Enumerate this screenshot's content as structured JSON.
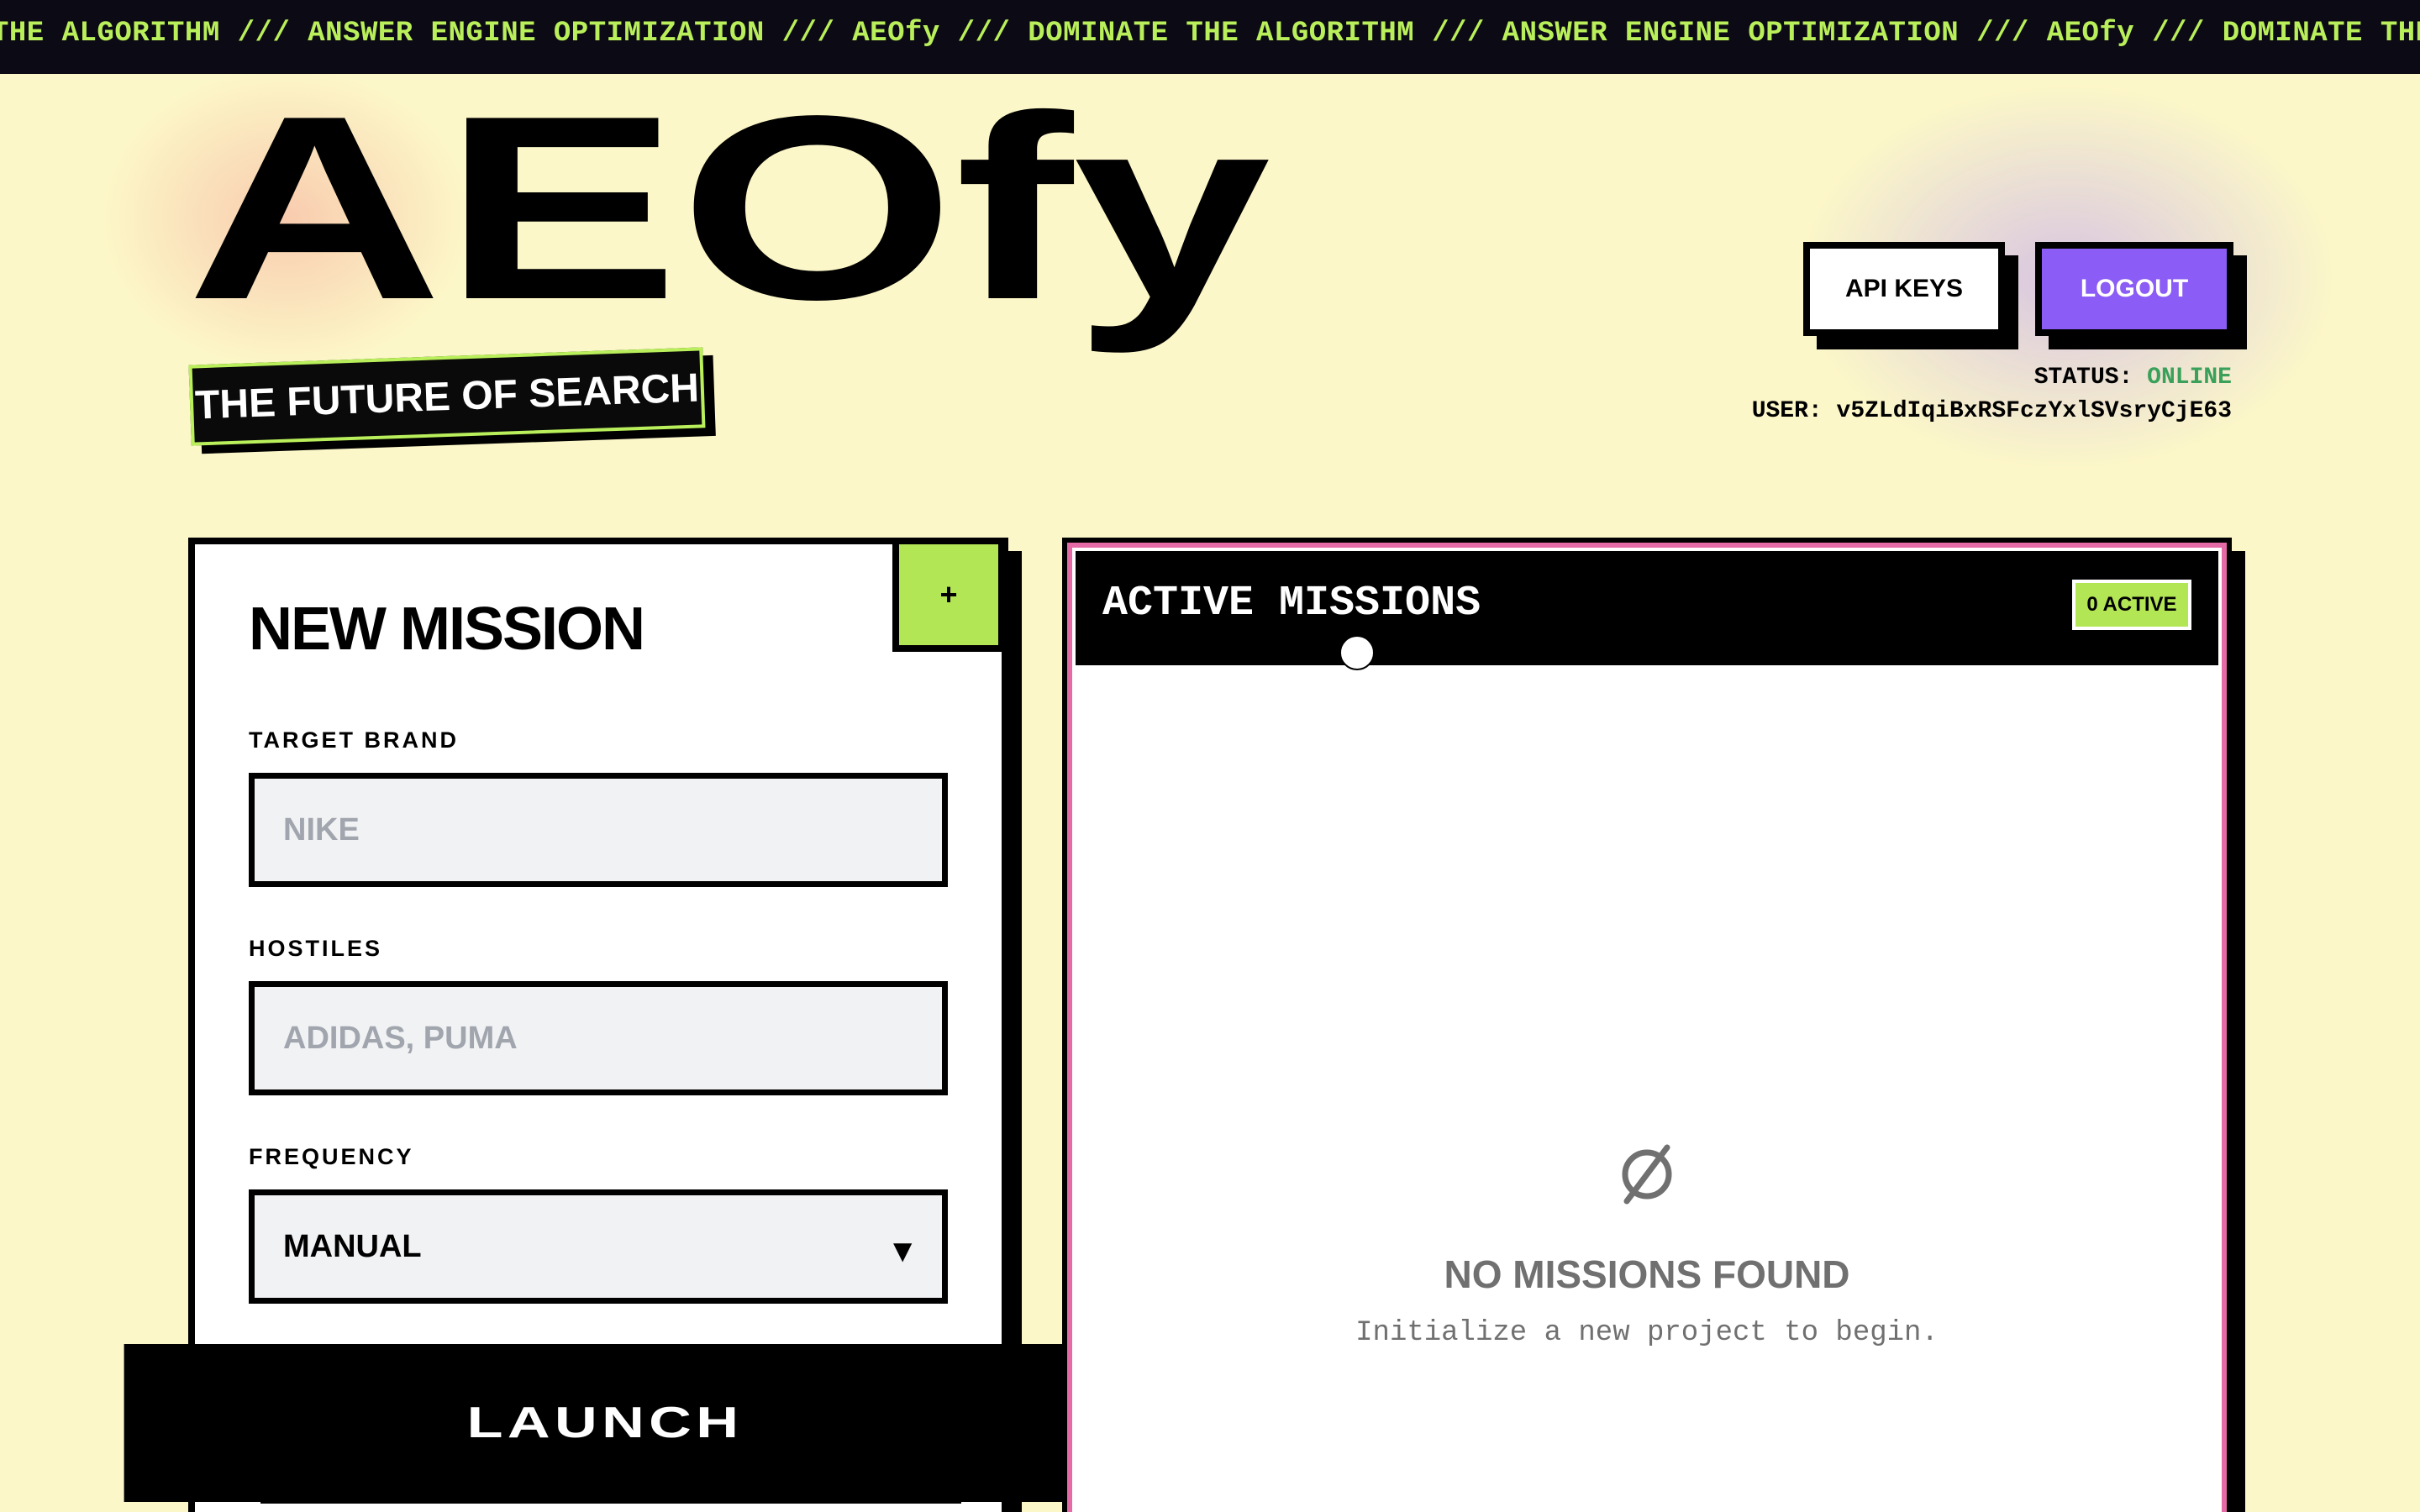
{
  "ticker": {
    "text": "THE ALGORITHM /// ANSWER ENGINE OPTIMIZATION /// AEOfy /// DOMINATE THE ALGORITHM /// ANSWER ENGINE OPTIMIZATION /// AEOfy /// DOMINATE THE ALGORITHM"
  },
  "brand": {
    "logo": "AEOfy",
    "tagline": "THE FUTURE OF SEARCH"
  },
  "header": {
    "api_keys_label": "API KEYS",
    "logout_label": "LOGOUT",
    "status_label": "STATUS:",
    "status_value": "ONLINE",
    "user_label": "USER:",
    "user_value": "v5ZLdIqiBxRSFczYxlSVsryCjE63"
  },
  "new_mission": {
    "title": "NEW MISSION",
    "plus_label": "+",
    "target_brand": {
      "label": "TARGET BRAND",
      "placeholder": "NIKE"
    },
    "hostiles": {
      "label": "HOSTILES",
      "placeholder": "ADIDAS, PUMA"
    },
    "frequency": {
      "label": "FREQUENCY",
      "value": "MANUAL",
      "arrow": "▼"
    },
    "launch_label": "LAUNCH"
  },
  "active_missions": {
    "title": "ACTIVE MISSIONS",
    "badge": "0 ACTIVE",
    "empty_title": "NO MISSIONS FOUND",
    "empty_subtitle": "Initialize a new project to begin."
  },
  "colors": {
    "background": "#fcf7c8",
    "ticker_bg": "#0c0a14",
    "accent_green": "#b3e655",
    "accent_purple": "#8b5cf6",
    "accent_pink": "#e56ba7",
    "status_online": "#3aa05a"
  },
  "icons": {
    "empty_state": "empty-set-icon",
    "plus": "plus-icon",
    "dropdown": "chevron-down-icon"
  }
}
